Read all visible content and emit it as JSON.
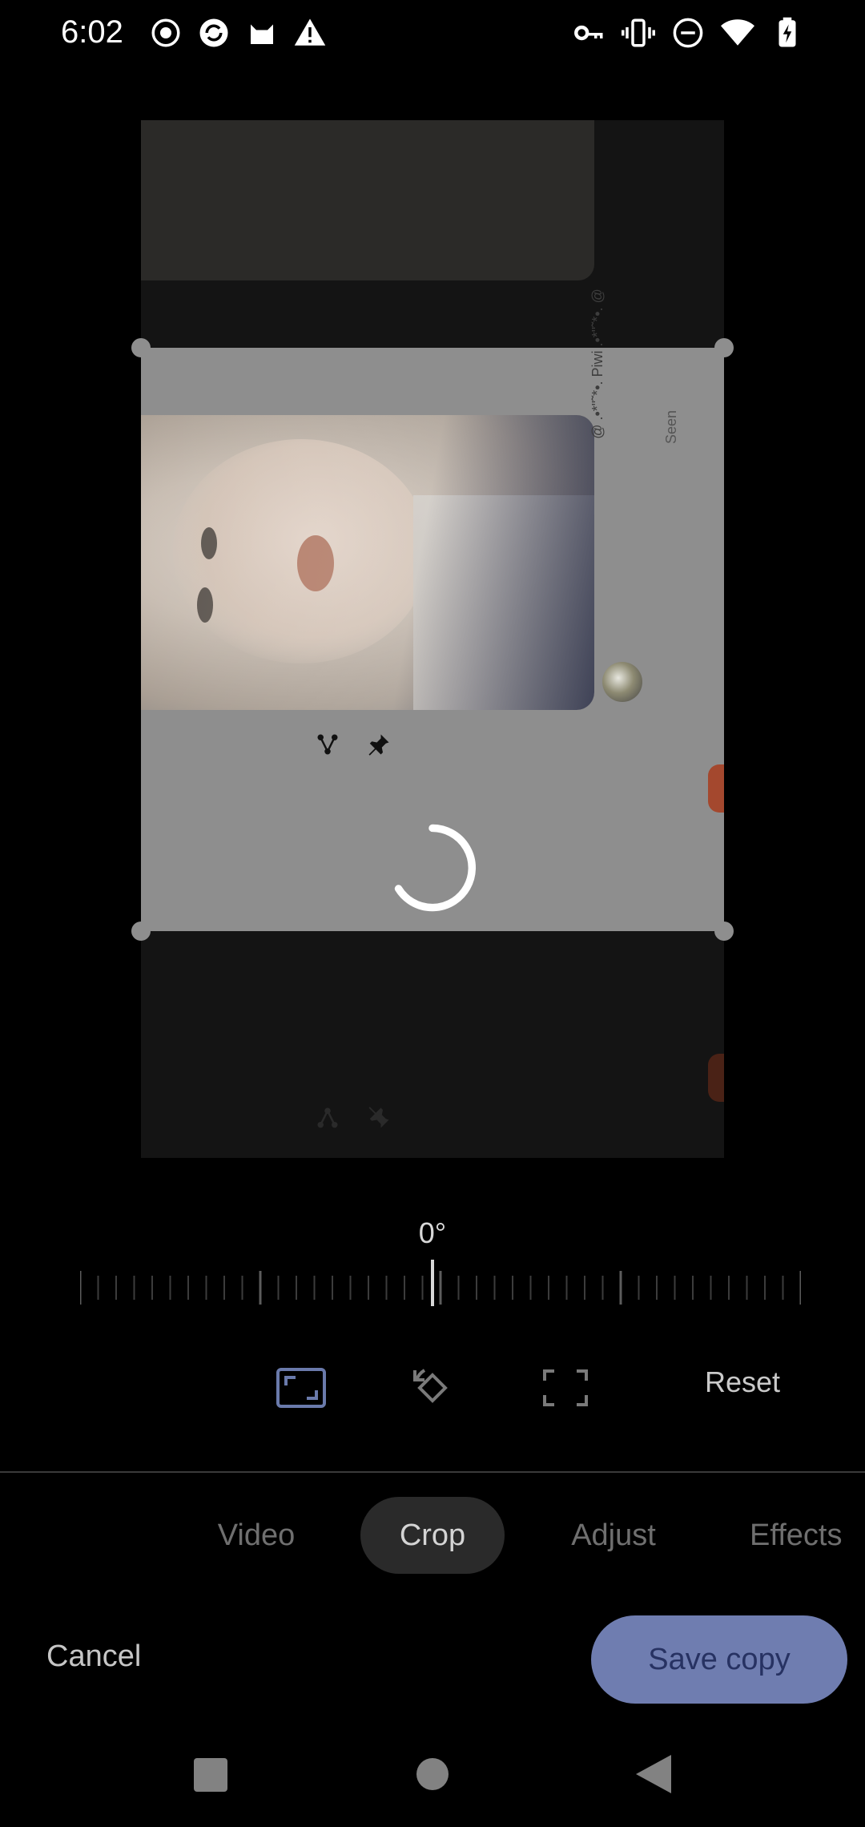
{
  "status_bar": {
    "time": "6:02",
    "left_icons": [
      "record-icon",
      "browser-icon",
      "cat-icon",
      "warning-icon"
    ],
    "right_icons": [
      "vpn-key-icon",
      "vibrate-icon",
      "do-not-disturb-icon",
      "wifi-icon",
      "battery-charging-icon"
    ]
  },
  "editor": {
    "post": {
      "name": "@ .•*\"˜*•. Piwi .•*\"˜*•. @",
      "seen": "Seen"
    },
    "loading": true
  },
  "rotation": {
    "angle": "0°"
  },
  "tools": {
    "aspect_ratio_icon": "aspect-ratio-icon",
    "rotate_icon": "rotate-icon",
    "free_crop_icon": "crop-free-icon",
    "reset_label": "Reset"
  },
  "tabs": [
    {
      "label": "Video",
      "active": false
    },
    {
      "label": "Crop",
      "active": true
    },
    {
      "label": "Adjust",
      "active": false
    },
    {
      "label": "Effects",
      "active": false
    }
  ],
  "actions": {
    "cancel_label": "Cancel",
    "save_label": "Save copy"
  },
  "colors": {
    "accent": "#6f7db0",
    "accent_text": "#273262",
    "active_tab_bg": "#2a2a2a"
  },
  "nav": {
    "recents": "recents-icon",
    "home": "home-icon",
    "back": "back-icon"
  }
}
